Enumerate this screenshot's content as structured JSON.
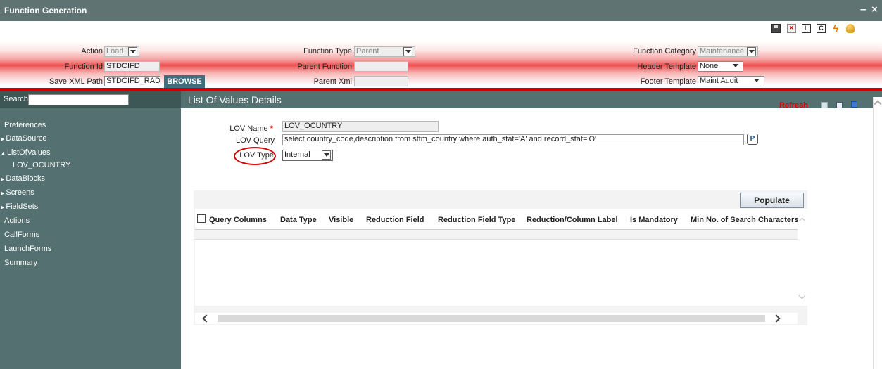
{
  "window": {
    "title": "Function Generation",
    "minimize": "–",
    "close": "×"
  },
  "toolbar": {
    "icons": [
      "save-icon",
      "close-icon",
      "l-icon",
      "c-icon",
      "lightning-icon",
      "database-icon"
    ],
    "l_label": "L",
    "c_label": "C",
    "close_glyph": "×",
    "bolt_glyph": "ϟ"
  },
  "header": {
    "action_label": "Action",
    "action_value": "Load",
    "function_id_label": "Function Id",
    "function_id_value": "STDCIFD",
    "save_xml_label": "Save XML Path",
    "save_xml_value": "STDCIFD_RAD",
    "browse_label": "BROWSE",
    "function_type_label": "Function Type",
    "function_type_value": "Parent",
    "parent_function_label": "Parent Function",
    "parent_function_value": "",
    "parent_xml_label": "Parent Xml",
    "parent_xml_value": "",
    "function_category_label": "Function Category",
    "function_category_value": "Maintenance",
    "header_template_label": "Header Template",
    "header_template_value": "None",
    "footer_template_label": "Footer Template",
    "footer_template_value": "Maint Audit"
  },
  "sidebar": {
    "search_label": "Search",
    "search_value": "",
    "items": [
      {
        "label": "Preferences",
        "tri": ""
      },
      {
        "label": "DataSource",
        "tri": "▶"
      },
      {
        "label": "ListOfValues",
        "tri": "▲"
      },
      {
        "label": "LOV_OCUNTRY",
        "tri": ""
      },
      {
        "label": "DataBlocks",
        "tri": "▶"
      },
      {
        "label": "Screens",
        "tri": "▶"
      },
      {
        "label": "FieldSets",
        "tri": "▶"
      },
      {
        "label": "Actions",
        "tri": ""
      },
      {
        "label": "CallForms",
        "tri": ""
      },
      {
        "label": "LaunchForms",
        "tri": ""
      },
      {
        "label": "Summary",
        "tri": ""
      }
    ]
  },
  "main": {
    "title": "List Of Values Details",
    "refresh": "Refresh",
    "lov_name_label": "LOV Name",
    "required_mark": "*",
    "lov_name_value": "LOV_OCUNTRY",
    "lov_query_label": "LOV Query",
    "lov_query_value": "select country_code,description from sttm_country where auth_stat='A' and record_stat='O'",
    "lov_type_label": "LOV Type",
    "lov_type_value": "Internal",
    "lookup_glyph": "P",
    "populate_label": "Populate",
    "columns": [
      "Query Columns",
      "Data Type",
      "Visible",
      "Reduction Field",
      "Reduction Field Type",
      "Reduction/Column Label",
      "Is Mandatory",
      "Min No. of Search Characters"
    ]
  },
  "colors": {
    "teal": "#547070",
    "title_bar": "#5f7373",
    "header_red": "#d00000",
    "refresh_red": "#d40000",
    "browse": "#3d6f7c"
  }
}
